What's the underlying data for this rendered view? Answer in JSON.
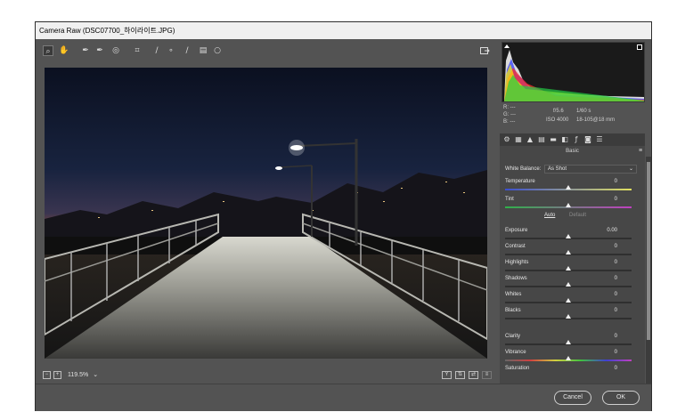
{
  "window": {
    "title": "Camera Raw (DSC07700_하이라이트.JPG)"
  },
  "toolbar": {
    "tools": [
      {
        "name": "zoom-tool-icon",
        "glyph": "⌕"
      },
      {
        "name": "hand-tool-icon",
        "glyph": "✋"
      },
      {
        "name": "white-balance-tool-icon",
        "glyph": "✒"
      },
      {
        "name": "color-sampler-tool-icon",
        "glyph": "✒"
      },
      {
        "name": "targeted-adjustment-tool-icon",
        "glyph": "◎"
      },
      {
        "name": "crop-tool-icon",
        "glyph": "⌗"
      },
      {
        "name": "straighten-tool-icon",
        "glyph": "∕"
      },
      {
        "name": "spot-removal-tool-icon",
        "glyph": "∘"
      },
      {
        "name": "adjustment-brush-icon",
        "glyph": "∕"
      },
      {
        "name": "graduated-filter-icon",
        "glyph": "▤"
      },
      {
        "name": "radial-filter-icon",
        "glyph": "○"
      }
    ],
    "right_icon": "open-preferences-icon"
  },
  "bottombar": {
    "zoom_level": "119.5%",
    "zoom_dropdown_glyph": "⌄"
  },
  "readout": {
    "r_label": "R:",
    "r_value": "---",
    "g_label": "G:",
    "g_value": "---",
    "b_label": "B:",
    "b_value": "---",
    "aperture": "f/5.6",
    "shutter": "1/60 s",
    "iso": "ISO 4000",
    "lens": "18-105@18 mm"
  },
  "panel": {
    "header": "Basic",
    "white_balance_label": "White Balance:",
    "white_balance_value": "As Shot",
    "auto_label": "Auto",
    "default_label": "Default",
    "sliders": [
      {
        "name": "temperature",
        "label": "Temperature",
        "value": "0",
        "level": 0.5
      },
      {
        "name": "tint",
        "label": "Tint",
        "value": "0",
        "level": 0.5
      },
      {
        "name": "exposure",
        "label": "Exposure",
        "value": "0.00",
        "level": 0.5
      },
      {
        "name": "contrast",
        "label": "Contrast",
        "value": "0",
        "level": 0.5
      },
      {
        "name": "highlights",
        "label": "Highlights",
        "value": "0",
        "level": 0.5
      },
      {
        "name": "shadows",
        "label": "Shadows",
        "value": "0",
        "level": 0.5
      },
      {
        "name": "whites",
        "label": "Whites",
        "value": "0",
        "level": 0.5
      },
      {
        "name": "blacks",
        "label": "Blacks",
        "value": "0",
        "level": 0.5
      },
      {
        "name": "clarity",
        "label": "Clarity",
        "value": "0",
        "level": 0.5
      },
      {
        "name": "vibrance",
        "label": "Vibrance",
        "value": "0",
        "level": 0.5
      },
      {
        "name": "saturation",
        "label": "Saturation",
        "value": "0",
        "level": 0.5
      }
    ]
  },
  "footer": {
    "cancel_label": "Cancel",
    "ok_label": "OK"
  },
  "colors": {
    "panel_bg": "#535353",
    "dark_bg": "#474747",
    "accent_white": "#f0f0f0"
  }
}
